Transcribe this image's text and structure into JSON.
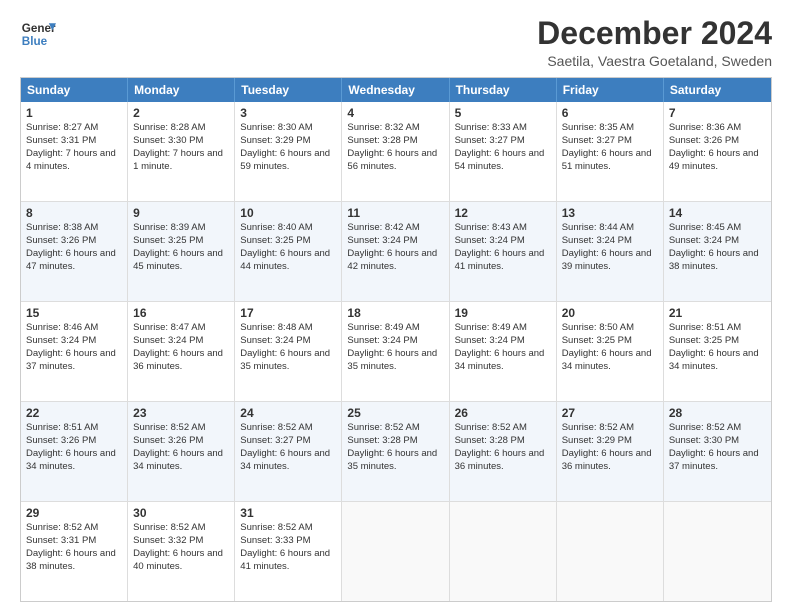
{
  "header": {
    "logo_line1": "General",
    "logo_line2": "Blue",
    "title": "December 2024",
    "subtitle": "Saetila, Vaestra Goetaland, Sweden"
  },
  "weekdays": [
    "Sunday",
    "Monday",
    "Tuesday",
    "Wednesday",
    "Thursday",
    "Friday",
    "Saturday"
  ],
  "weeks": [
    [
      {
        "day": "1",
        "sr": "Sunrise: 8:27 AM",
        "ss": "Sunset: 3:31 PM",
        "dl": "Daylight: 7 hours and 4 minutes."
      },
      {
        "day": "2",
        "sr": "Sunrise: 8:28 AM",
        "ss": "Sunset: 3:30 PM",
        "dl": "Daylight: 7 hours and 1 minute."
      },
      {
        "day": "3",
        "sr": "Sunrise: 8:30 AM",
        "ss": "Sunset: 3:29 PM",
        "dl": "Daylight: 6 hours and 59 minutes."
      },
      {
        "day": "4",
        "sr": "Sunrise: 8:32 AM",
        "ss": "Sunset: 3:28 PM",
        "dl": "Daylight: 6 hours and 56 minutes."
      },
      {
        "day": "5",
        "sr": "Sunrise: 8:33 AM",
        "ss": "Sunset: 3:27 PM",
        "dl": "Daylight: 6 hours and 54 minutes."
      },
      {
        "day": "6",
        "sr": "Sunrise: 8:35 AM",
        "ss": "Sunset: 3:27 PM",
        "dl": "Daylight: 6 hours and 51 minutes."
      },
      {
        "day": "7",
        "sr": "Sunrise: 8:36 AM",
        "ss": "Sunset: 3:26 PM",
        "dl": "Daylight: 6 hours and 49 minutes."
      }
    ],
    [
      {
        "day": "8",
        "sr": "Sunrise: 8:38 AM",
        "ss": "Sunset: 3:26 PM",
        "dl": "Daylight: 6 hours and 47 minutes."
      },
      {
        "day": "9",
        "sr": "Sunrise: 8:39 AM",
        "ss": "Sunset: 3:25 PM",
        "dl": "Daylight: 6 hours and 45 minutes."
      },
      {
        "day": "10",
        "sr": "Sunrise: 8:40 AM",
        "ss": "Sunset: 3:25 PM",
        "dl": "Daylight: 6 hours and 44 minutes."
      },
      {
        "day": "11",
        "sr": "Sunrise: 8:42 AM",
        "ss": "Sunset: 3:24 PM",
        "dl": "Daylight: 6 hours and 42 minutes."
      },
      {
        "day": "12",
        "sr": "Sunrise: 8:43 AM",
        "ss": "Sunset: 3:24 PM",
        "dl": "Daylight: 6 hours and 41 minutes."
      },
      {
        "day": "13",
        "sr": "Sunrise: 8:44 AM",
        "ss": "Sunset: 3:24 PM",
        "dl": "Daylight: 6 hours and 39 minutes."
      },
      {
        "day": "14",
        "sr": "Sunrise: 8:45 AM",
        "ss": "Sunset: 3:24 PM",
        "dl": "Daylight: 6 hours and 38 minutes."
      }
    ],
    [
      {
        "day": "15",
        "sr": "Sunrise: 8:46 AM",
        "ss": "Sunset: 3:24 PM",
        "dl": "Daylight: 6 hours and 37 minutes."
      },
      {
        "day": "16",
        "sr": "Sunrise: 8:47 AM",
        "ss": "Sunset: 3:24 PM",
        "dl": "Daylight: 6 hours and 36 minutes."
      },
      {
        "day": "17",
        "sr": "Sunrise: 8:48 AM",
        "ss": "Sunset: 3:24 PM",
        "dl": "Daylight: 6 hours and 35 minutes."
      },
      {
        "day": "18",
        "sr": "Sunrise: 8:49 AM",
        "ss": "Sunset: 3:24 PM",
        "dl": "Daylight: 6 hours and 35 minutes."
      },
      {
        "day": "19",
        "sr": "Sunrise: 8:49 AM",
        "ss": "Sunset: 3:24 PM",
        "dl": "Daylight: 6 hours and 34 minutes."
      },
      {
        "day": "20",
        "sr": "Sunrise: 8:50 AM",
        "ss": "Sunset: 3:25 PM",
        "dl": "Daylight: 6 hours and 34 minutes."
      },
      {
        "day": "21",
        "sr": "Sunrise: 8:51 AM",
        "ss": "Sunset: 3:25 PM",
        "dl": "Daylight: 6 hours and 34 minutes."
      }
    ],
    [
      {
        "day": "22",
        "sr": "Sunrise: 8:51 AM",
        "ss": "Sunset: 3:26 PM",
        "dl": "Daylight: 6 hours and 34 minutes."
      },
      {
        "day": "23",
        "sr": "Sunrise: 8:52 AM",
        "ss": "Sunset: 3:26 PM",
        "dl": "Daylight: 6 hours and 34 minutes."
      },
      {
        "day": "24",
        "sr": "Sunrise: 8:52 AM",
        "ss": "Sunset: 3:27 PM",
        "dl": "Daylight: 6 hours and 34 minutes."
      },
      {
        "day": "25",
        "sr": "Sunrise: 8:52 AM",
        "ss": "Sunset: 3:28 PM",
        "dl": "Daylight: 6 hours and 35 minutes."
      },
      {
        "day": "26",
        "sr": "Sunrise: 8:52 AM",
        "ss": "Sunset: 3:28 PM",
        "dl": "Daylight: 6 hours and 36 minutes."
      },
      {
        "day": "27",
        "sr": "Sunrise: 8:52 AM",
        "ss": "Sunset: 3:29 PM",
        "dl": "Daylight: 6 hours and 36 minutes."
      },
      {
        "day": "28",
        "sr": "Sunrise: 8:52 AM",
        "ss": "Sunset: 3:30 PM",
        "dl": "Daylight: 6 hours and 37 minutes."
      }
    ],
    [
      {
        "day": "29",
        "sr": "Sunrise: 8:52 AM",
        "ss": "Sunset: 3:31 PM",
        "dl": "Daylight: 6 hours and 38 minutes."
      },
      {
        "day": "30",
        "sr": "Sunrise: 8:52 AM",
        "ss": "Sunset: 3:32 PM",
        "dl": "Daylight: 6 hours and 40 minutes."
      },
      {
        "day": "31",
        "sr": "Sunrise: 8:52 AM",
        "ss": "Sunset: 3:33 PM",
        "dl": "Daylight: 6 hours and 41 minutes."
      },
      {
        "day": "",
        "sr": "",
        "ss": "",
        "dl": ""
      },
      {
        "day": "",
        "sr": "",
        "ss": "",
        "dl": ""
      },
      {
        "day": "",
        "sr": "",
        "ss": "",
        "dl": ""
      },
      {
        "day": "",
        "sr": "",
        "ss": "",
        "dl": ""
      }
    ]
  ]
}
